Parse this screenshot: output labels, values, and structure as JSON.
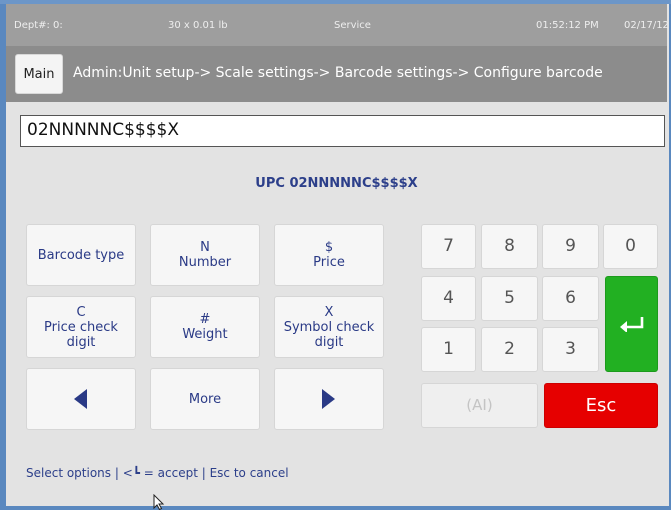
{
  "status": {
    "dept": "Dept#: 0:",
    "weight": "30 x 0.01 lb",
    "mode": "Service",
    "time": "01:52:12 PM",
    "date": "02/17/12"
  },
  "header": {
    "main_label": "Main",
    "breadcrumb": "Admin:Unit setup-> Scale settings-> Barcode settings-> Configure barcode"
  },
  "entry": {
    "value": "02NNNNNC$$$$X"
  },
  "upc_label": "UPC 02NNNNNC$$$$X",
  "options": {
    "barcode_type": "Barcode type",
    "number_symbol": "N",
    "number_label": "Number",
    "price_symbol": "$",
    "price_label": "Price",
    "pricecheck_symbol": "C",
    "pricecheck_line1": "Price check",
    "pricecheck_line2": "digit",
    "weight_symbol": "#",
    "weight_label": "Weight",
    "symcheck_symbol": "X",
    "symcheck_line1": "Symbol check",
    "symcheck_line2": "digit",
    "more": "More"
  },
  "keypad": {
    "k7": "7",
    "k8": "8",
    "k9": "9",
    "k0": "0",
    "k4": "4",
    "k5": "5",
    "k6": "6",
    "k1": "1",
    "k2": "2",
    "k3": "3",
    "ai": "(AI)",
    "esc": "Esc"
  },
  "hint": "Select options | <┗ = accept | Esc to cancel",
  "colors": {
    "enter": "#22b022",
    "esc": "#e60000",
    "accent_text": "#2c3f8a"
  },
  "icons": [
    "arrow-left-icon",
    "arrow-right-icon",
    "enter-return-icon",
    "mouse-cursor-icon"
  ]
}
